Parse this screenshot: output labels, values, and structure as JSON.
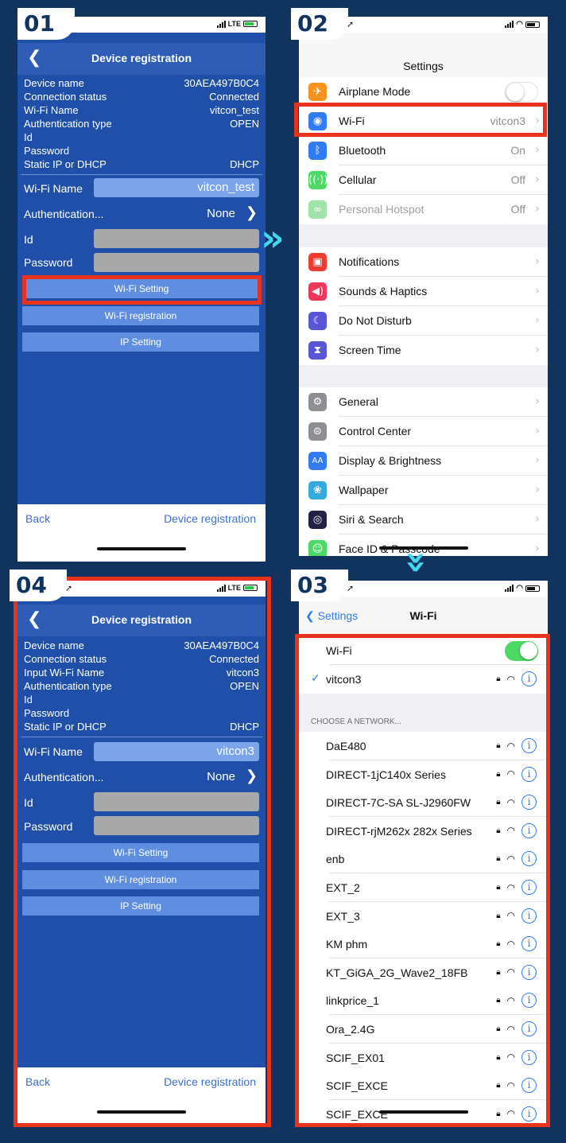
{
  "steps": {
    "s1": "01",
    "s2": "02",
    "s3": "03",
    "s4": "04"
  },
  "status": {
    "carrier_lte": "LTE"
  },
  "screen1": {
    "title": "Device registration",
    "info": [
      {
        "k": "Device name",
        "v": "30AEA497B0C4"
      },
      {
        "k": "Connection status",
        "v": "Connected"
      },
      {
        "k": "Wi-Fi Name",
        "v": "vitcon_test"
      },
      {
        "k": "Authentication type",
        "v": "OPEN"
      },
      {
        "k": "Id",
        "v": ""
      },
      {
        "k": "Password",
        "v": ""
      },
      {
        "k": "Static IP or DHCP",
        "v": "DHCP"
      }
    ],
    "wifi_name_label": "Wi-Fi Name",
    "wifi_name_value": "vitcon_test",
    "auth_label": "Authentication...",
    "auth_value": "None",
    "id_label": "Id",
    "password_label": "Password",
    "btn_wifi_setting": "Wi-Fi Setting",
    "btn_wifi_registration": "Wi-Fi registration",
    "btn_ip_setting": "IP Setting",
    "back": "Back",
    "device_registration": "Device registration"
  },
  "screen4": {
    "title": "Device registration",
    "info": [
      {
        "k": "Device name",
        "v": "30AEA497B0C4"
      },
      {
        "k": "Connection status",
        "v": "Connected"
      },
      {
        "k": "Input Wi-Fi Name",
        "v": "vitcon3"
      },
      {
        "k": "Authentication type",
        "v": "OPEN"
      },
      {
        "k": "Id",
        "v": ""
      },
      {
        "k": "Password",
        "v": ""
      },
      {
        "k": "Static IP or DHCP",
        "v": "DHCP"
      }
    ],
    "wifi_name_label": "Wi-Fi Name",
    "wifi_name_value": "vitcon3",
    "auth_label": "Authentication...",
    "auth_value": "None",
    "id_label": "Id",
    "password_label": "Password",
    "btn_wifi_setting": "Wi-Fi Setting",
    "btn_wifi_registration": "Wi-Fi registration",
    "btn_ip_setting": "IP Setting",
    "back": "Back",
    "device_registration": "Device registration"
  },
  "settings": {
    "title": "Settings",
    "rows": [
      {
        "label": "Airplane Mode",
        "value": "",
        "icon": "airplane-icon",
        "color": "#f7931e"
      },
      {
        "label": "Wi-Fi",
        "value": "vitcon3",
        "icon": "wifi-icon",
        "color": "#2f7cf6"
      },
      {
        "label": "Bluetooth",
        "value": "On",
        "icon": "bluetooth-icon",
        "color": "#2f7cf6"
      },
      {
        "label": "Cellular",
        "value": "Off",
        "icon": "cellular-icon",
        "color": "#4cd964"
      },
      {
        "label": "Personal Hotspot",
        "value": "Off",
        "icon": "hotspot-icon",
        "color": "#9fe3a8"
      },
      {
        "label": "Notifications",
        "value": "",
        "icon": "notifications-icon",
        "color": "#f23b30"
      },
      {
        "label": "Sounds & Haptics",
        "value": "",
        "icon": "sounds-icon",
        "color": "#f2365a"
      },
      {
        "label": "Do Not Disturb",
        "value": "",
        "icon": "moon-icon",
        "color": "#5856d6"
      },
      {
        "label": "Screen Time",
        "value": "",
        "icon": "hourglass-icon",
        "color": "#5856d6"
      },
      {
        "label": "General",
        "value": "",
        "icon": "gear-icon",
        "color": "#8e8e93"
      },
      {
        "label": "Control Center",
        "value": "",
        "icon": "switches-icon",
        "color": "#8e8e93"
      },
      {
        "label": "Display & Brightness",
        "value": "",
        "icon": "display-icon",
        "color": "#2f7cf6"
      },
      {
        "label": "Wallpaper",
        "value": "",
        "icon": "wallpaper-icon",
        "color": "#35aadc"
      },
      {
        "label": "Siri & Search",
        "value": "",
        "icon": "siri-icon",
        "color": "#222244"
      },
      {
        "label": "Face ID & Passcode",
        "value": "",
        "icon": "faceid-icon",
        "color": "#4cd964"
      }
    ]
  },
  "wifi": {
    "back": "Settings",
    "title": "Wi-Fi",
    "toggle_label": "Wi-Fi",
    "connected": "vitcon3",
    "section": "CHOOSE A NETWORK...",
    "networks": [
      "DaE480",
      "DIRECT-1jC140x Series",
      "DIRECT-7C-SA SL-J2960FW",
      "DIRECT-rjM262x 282x Series",
      "enb",
      "EXT_2",
      "EXT_3",
      "KM phm",
      "KT_GiGA_2G_Wave2_18FB",
      "linkprice_1",
      "Ora_2.4G",
      "SCIF_EX01",
      "SCIF_EXCE",
      "SCIF_EXCE"
    ]
  },
  "colors": {
    "background": "#11345f",
    "highlight": "#e8321c",
    "arrow": "#41d8ef",
    "app_blue": "#1f4fa8"
  }
}
